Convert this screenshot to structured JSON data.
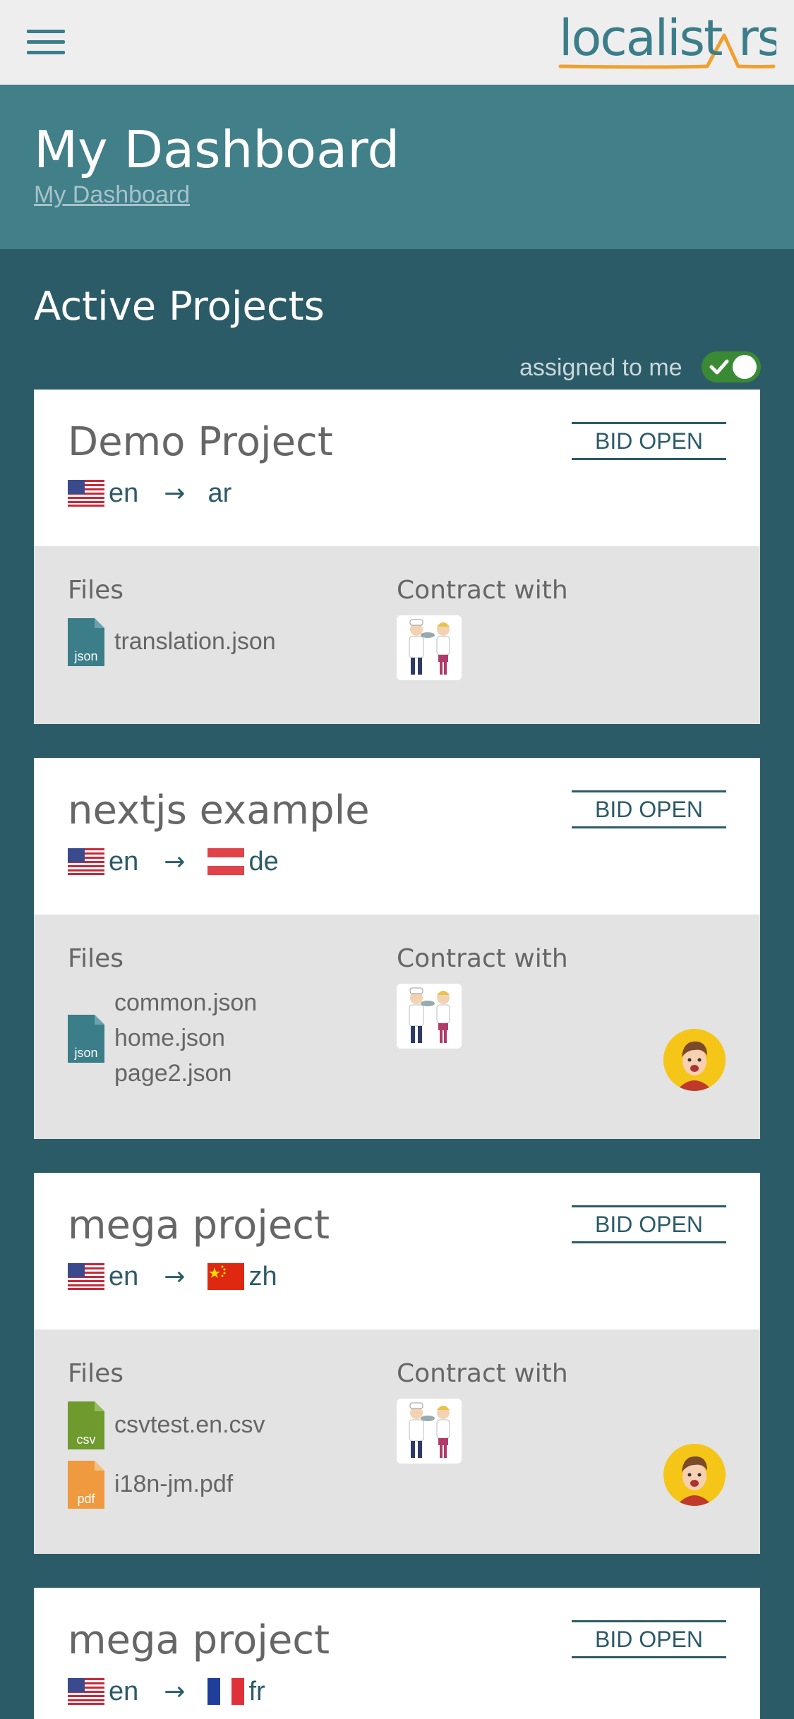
{
  "header": {
    "logo_text": "localistars",
    "page_title": "My Dashboard",
    "breadcrumb": "My Dashboard"
  },
  "section": {
    "title": "Active Projects",
    "assigned_label": "assigned to me",
    "assigned_toggle_on": true
  },
  "labels": {
    "files": "Files",
    "contract_with": "Contract with",
    "arrow": "→"
  },
  "projects": [
    {
      "name": "Demo Project",
      "status": "BID OPEN",
      "source_lang": "en",
      "target_lang": "ar",
      "files": [
        "translation.json"
      ]
    },
    {
      "name": "nextjs example",
      "status": "BID OPEN",
      "source_lang": "en",
      "target_lang": "de",
      "files": [
        "common.json",
        "home.json",
        "page2.json"
      ]
    },
    {
      "name": "mega project",
      "status": "BID OPEN",
      "source_lang": "en",
      "target_lang": "zh",
      "files": [
        "csvtest.en.csv",
        "i18n-jm.pdf"
      ]
    },
    {
      "name": "mega project",
      "status": "BID OPEN",
      "source_lang": "en",
      "target_lang": "fr",
      "files": []
    }
  ],
  "file_types": {
    "json": "json",
    "csv": "csv",
    "pdf": "pdf"
  },
  "colors": {
    "topbar": "#eeeeee",
    "header": "#417f89",
    "background": "#2c5b68",
    "accent_orange": "#f0a030",
    "json_icon": "#3b7d89",
    "csv_icon": "#6e9a2e",
    "pdf_icon": "#ef9a3e",
    "toggle_on": "#3a8a35"
  }
}
